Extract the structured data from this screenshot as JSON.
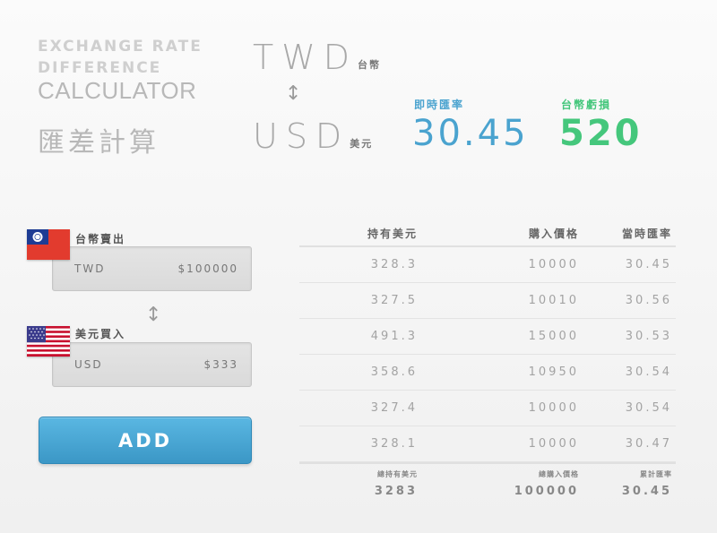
{
  "header": {
    "title_line1": "EXCHANGE RATE",
    "title_line2": "DIFFERENCE",
    "title_line3": "CALCULATOR",
    "title_zh": "匯差計算",
    "from_code": "TWD",
    "from_name": "台幣",
    "to_code": "USD",
    "to_name": "美元",
    "swap_glyph": "↕",
    "rate_label": "即時匯率",
    "rate_value": "30.45",
    "loss_label": "台幣虧損",
    "loss_value": "520"
  },
  "form": {
    "sell_label": "台幣賣出",
    "sell_currency": "TWD",
    "sell_amount": "$100000",
    "swap_glyph": "↕",
    "buy_label": "美元買入",
    "buy_currency": "USD",
    "buy_amount": "$333",
    "add_label": "ADD"
  },
  "table": {
    "headers": [
      "持有美元",
      "購入價格",
      "當時匯率"
    ],
    "rows": [
      [
        "328.3",
        "10000",
        "30.45"
      ],
      [
        "327.5",
        "10010",
        "30.56"
      ],
      [
        "491.3",
        "15000",
        "30.53"
      ],
      [
        "358.6",
        "10950",
        "30.54"
      ],
      [
        "327.4",
        "10000",
        "30.54"
      ],
      [
        "328.1",
        "10000",
        "30.47"
      ]
    ],
    "footer_labels": [
      "總持有美元",
      "總購入價格",
      "累計匯率"
    ],
    "footer_values": [
      "3283",
      "100000",
      "30.45"
    ]
  },
  "colors": {
    "accent_blue": "#4aa3cf",
    "accent_green": "#45c77c",
    "button": "#46a5d4"
  },
  "icons": {
    "taiwan_flag": "taiwan-flag-icon",
    "usa_flag": "usa-flag-icon",
    "swap": "swap-vertical-icon"
  }
}
